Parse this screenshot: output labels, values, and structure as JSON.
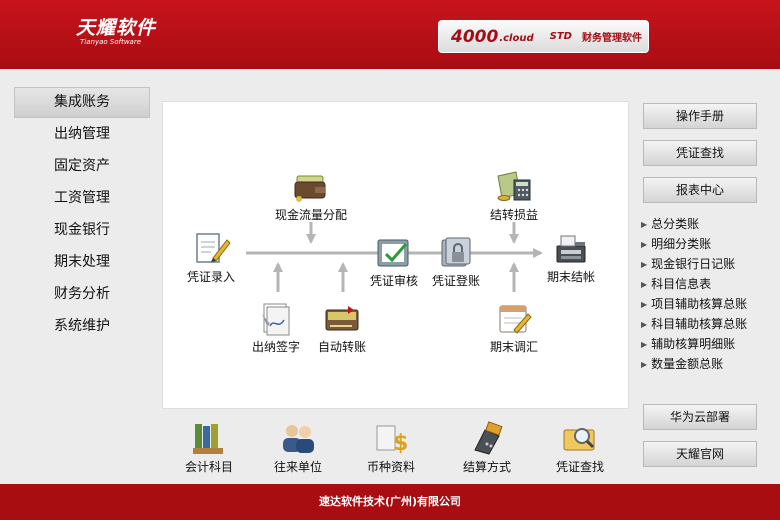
{
  "header": {
    "logo_cn": "天耀软件",
    "logo_en": "Tianyao Software",
    "product_num": "4000",
    "product_cloud": ".cloud",
    "product_std": "STD",
    "product_name": "财务管理软件"
  },
  "left_nav": {
    "items": [
      {
        "label": "集成账务"
      },
      {
        "label": "出纳管理"
      },
      {
        "label": "固定资产"
      },
      {
        "label": "工资管理"
      },
      {
        "label": "现金银行"
      },
      {
        "label": "期末处理"
      },
      {
        "label": "财务分析"
      },
      {
        "label": "系统维护"
      }
    ],
    "active_index": 0
  },
  "flow": {
    "voucher_entry": "凭证录入",
    "cash_flow": "现金流量分配",
    "cashier_sign": "出纳签字",
    "auto_transfer": "自动转账",
    "voucher_audit": "凭证审核",
    "voucher_post": "凭证登账",
    "transfer_pl": "结转损益",
    "period_adjust": "期末调汇",
    "period_close": "期末结帐"
  },
  "bottom_tools": [
    {
      "label": "会计科目",
      "icon": "ledger-binders-icon"
    },
    {
      "label": "往来单位",
      "icon": "people-icon"
    },
    {
      "label": "币种资料",
      "icon": "currency-icon"
    },
    {
      "label": "结算方式",
      "icon": "card-terminal-icon"
    },
    {
      "label": "凭证查找",
      "icon": "search-folder-icon"
    }
  ],
  "right": {
    "manual": "操作手册",
    "voucher_search": "凭证查找",
    "report_center": "报表中心",
    "reports": [
      {
        "label": "总分类账"
      },
      {
        "label": "明细分类账"
      },
      {
        "label": "现金银行日记账"
      },
      {
        "label": "科目信息表"
      },
      {
        "label": "项目辅助核算总账"
      },
      {
        "label": "科目辅助核算总账"
      },
      {
        "label": "辅助核算明细账"
      },
      {
        "label": "数量金额总账"
      }
    ],
    "huawei": "华为云部署",
    "official": "天耀官网"
  },
  "footer": {
    "text": "速达软件技术(广州)有限公司"
  },
  "colors": {
    "brand_red": "#b8111a",
    "arrow_gray": "#b5b5b5"
  }
}
